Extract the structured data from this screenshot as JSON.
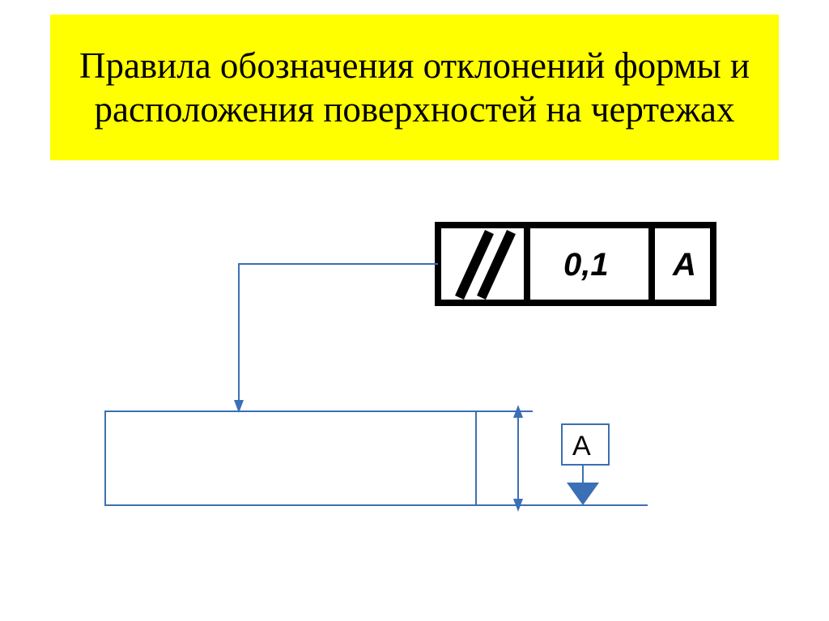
{
  "title": "Правила обозначения отклонений формы и расположения поверхностей на чертежах",
  "controlFrame": {
    "symbolName": "parallelism-icon",
    "tolerance": "0,1",
    "datum": "A"
  },
  "datumLabel": "А",
  "colors": {
    "titleBg": "#ffff00",
    "drawingStroke": "#3b6fb6",
    "frameStroke": "#000000"
  }
}
